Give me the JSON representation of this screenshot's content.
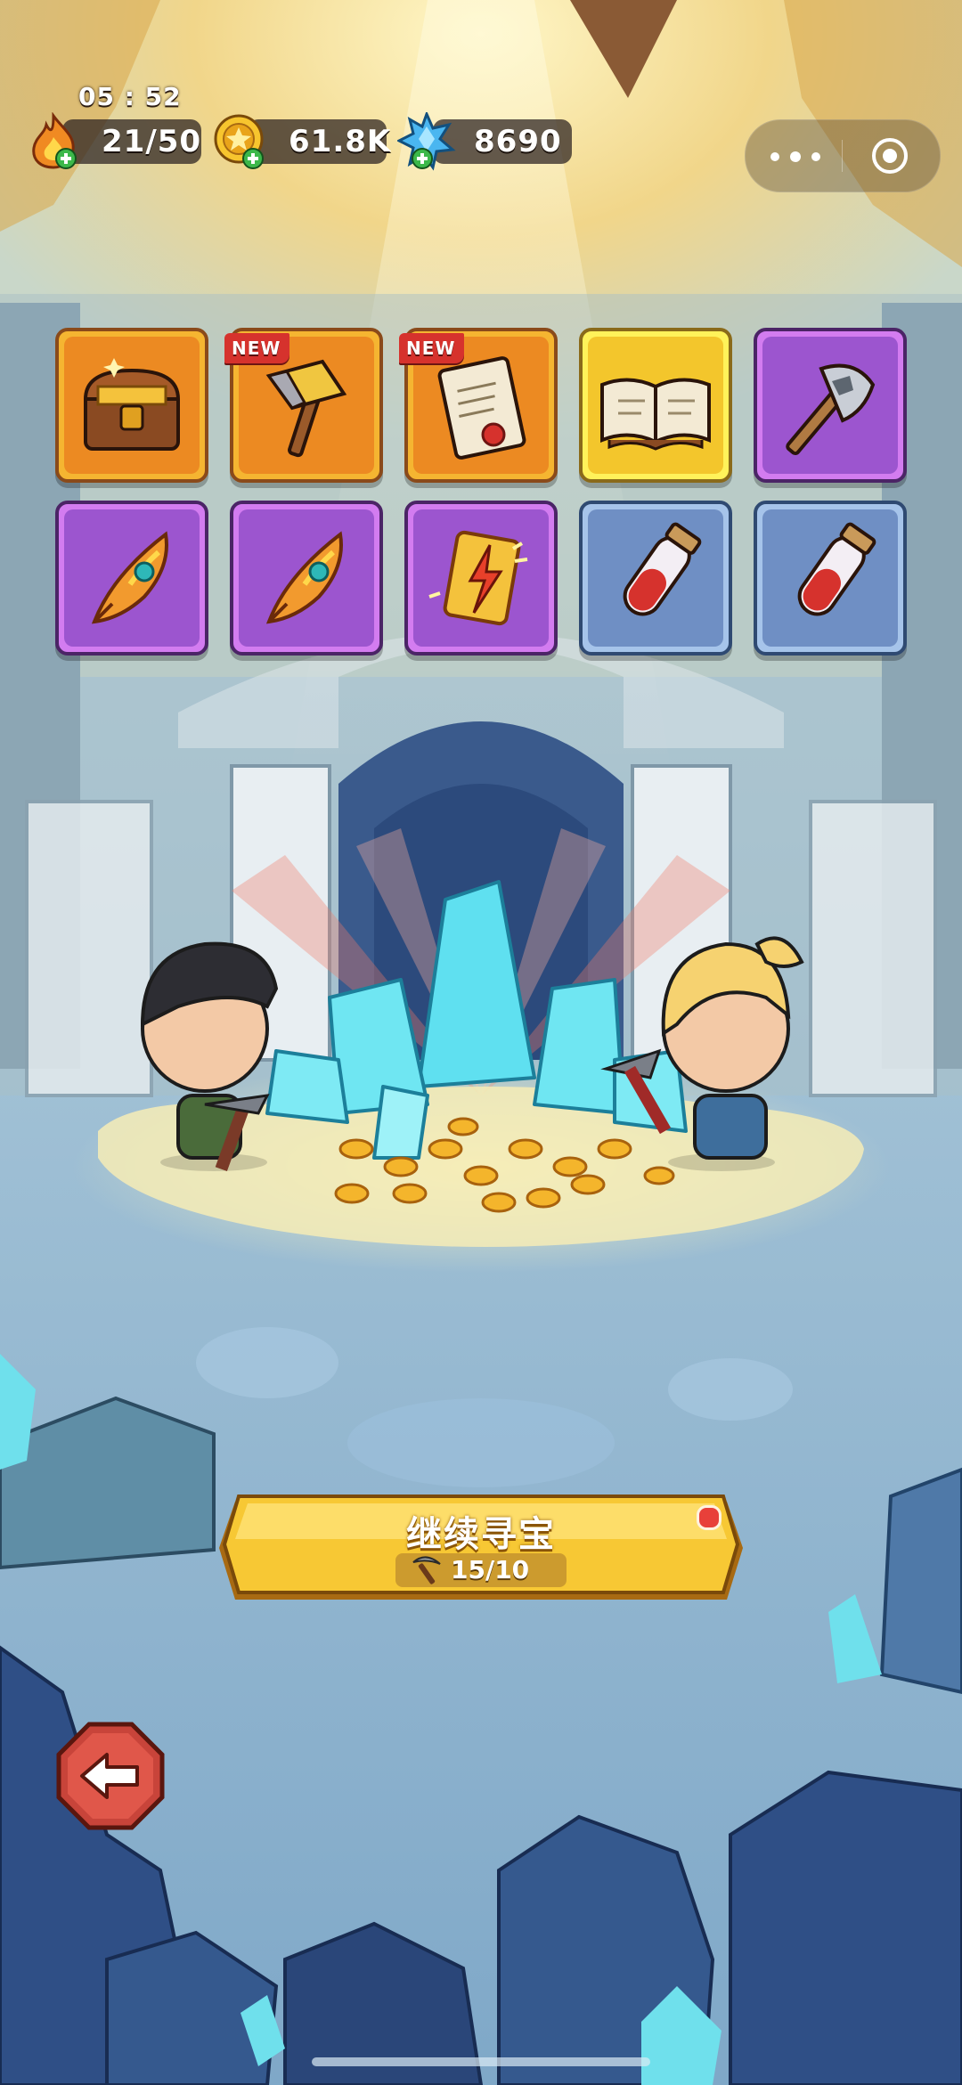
{
  "status": {
    "time": "05 : 52"
  },
  "resources": [
    {
      "name": "energy",
      "icon": "flame-icon",
      "value": "21/50"
    },
    {
      "name": "coins",
      "icon": "gold-coin-icon",
      "value": "61.8K"
    },
    {
      "name": "gems",
      "icon": "blue-crystal-icon",
      "value": "8690"
    }
  ],
  "capsule": {
    "more_icon": "more-dots-icon",
    "close_icon": "target-circle-icon"
  },
  "rewards": [
    {
      "item": "treasure-chest-icon",
      "rarity": "orange",
      "tag": ""
    },
    {
      "item": "war-hammer-icon",
      "rarity": "orange",
      "tag": "NEW"
    },
    {
      "item": "scroll-letter-icon",
      "rarity": "orange",
      "tag": "NEW"
    },
    {
      "item": "spell-book-icon",
      "rarity": "yellow",
      "tag": ""
    },
    {
      "item": "battle-axe-icon",
      "rarity": "purple",
      "tag": ""
    },
    {
      "item": "phoenix-feather-icon",
      "rarity": "purple",
      "tag": ""
    },
    {
      "item": "phoenix-feather-icon",
      "rarity": "purple",
      "tag": ""
    },
    {
      "item": "lightning-card-icon",
      "rarity": "purple",
      "tag": ""
    },
    {
      "item": "red-potion-icon",
      "rarity": "blue",
      "tag": ""
    },
    {
      "item": "red-potion-icon",
      "rarity": "blue",
      "tag": ""
    }
  ],
  "continue_button": {
    "label": "继续寻宝",
    "progress": "15/10",
    "icon": "pickaxe-icon"
  },
  "back_button": {
    "icon": "back-arrow-icon"
  },
  "colors": {
    "gold_button": "#f7c834",
    "cave_blue": "#8fb7d3",
    "crystal": "#5fe0f0"
  }
}
